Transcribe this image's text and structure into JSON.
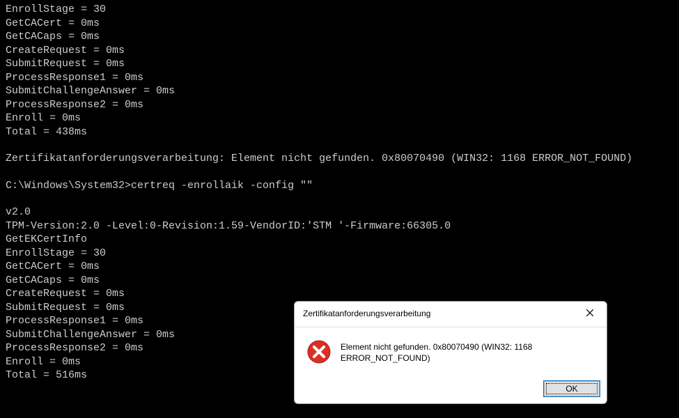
{
  "terminal": {
    "lines": [
      "EnrollStage = 30",
      "GetCACert = 0ms",
      "GetCACaps = 0ms",
      "CreateRequest = 0ms",
      "SubmitRequest = 0ms",
      "ProcessResponse1 = 0ms",
      "SubmitChallengeAnswer = 0ms",
      "ProcessResponse2 = 0ms",
      "Enroll = 0ms",
      "Total = 438ms",
      "",
      "Zertifikatanforderungsverarbeitung: Element nicht gefunden. 0x80070490 (WIN32: 1168 ERROR_NOT_FOUND)",
      "",
      "C:\\Windows\\System32>certreq -enrollaik -config \"\"",
      "",
      "v2.0",
      "TPM-Version:2.0 -Level:0-Revision:1.59-VendorID:'STM '-Firmware:66305.0",
      "GetEKCertInfo",
      "EnrollStage = 30",
      "GetCACert = 0ms",
      "GetCACaps = 0ms",
      "CreateRequest = 0ms",
      "SubmitRequest = 0ms",
      "ProcessResponse1 = 0ms",
      "SubmitChallengeAnswer = 0ms",
      "ProcessResponse2 = 0ms",
      "Enroll = 0ms",
      "Total = 516ms"
    ]
  },
  "dialog": {
    "title": "Zertifikatanforderungsverarbeitung",
    "message": "Element nicht gefunden. 0x80070490 (WIN32: 1168 ERROR_NOT_FOUND)",
    "ok_label": "OK"
  }
}
